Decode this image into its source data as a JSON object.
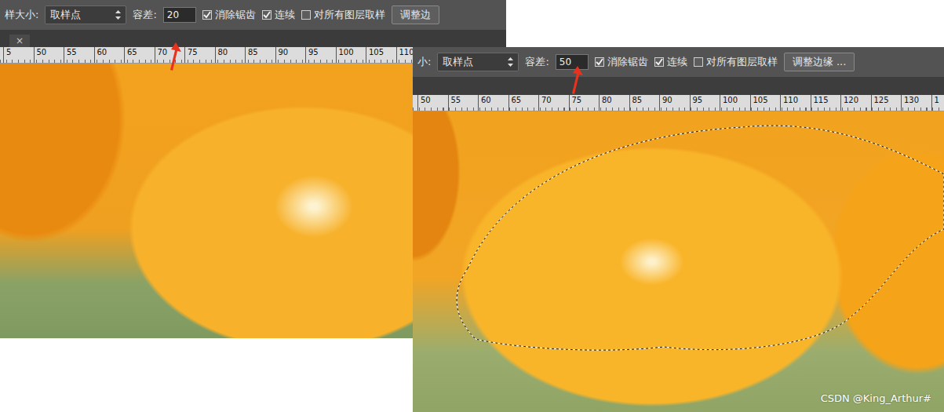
{
  "left": {
    "toolbar": {
      "sample_size_label": "样大小:",
      "sample_size_value": "取样点",
      "tolerance_label": "容差:",
      "tolerance_value": "20",
      "options": [
        {
          "label": "消除锯齿",
          "checked": true
        },
        {
          "label": "连续",
          "checked": true
        },
        {
          "label": "对所有图层取样",
          "checked": false
        }
      ],
      "refine_button": "调整边"
    },
    "tab_close": "×",
    "ruler": [
      "5",
      "50",
      "55",
      "60",
      "65",
      "70",
      "75",
      "80",
      "85",
      "90",
      "95",
      "100",
      "105",
      "110"
    ]
  },
  "right": {
    "toolbar": {
      "sample_size_label": "小:",
      "sample_size_value": "取样点",
      "tolerance_label": "容差:",
      "tolerance_value": "50",
      "options": [
        {
          "label": "消除锯齿",
          "checked": true
        },
        {
          "label": "连续",
          "checked": true
        },
        {
          "label": "对所有图层取样",
          "checked": false
        }
      ],
      "refine_button": "调整边缘 ..."
    },
    "ruler": [
      "50",
      "55",
      "60",
      "65",
      "70",
      "75",
      "80",
      "85",
      "90",
      "95",
      "100",
      "105",
      "110",
      "115",
      "120",
      "125",
      "130",
      "1"
    ]
  },
  "watermark": "CSDN @King_Arthur#"
}
